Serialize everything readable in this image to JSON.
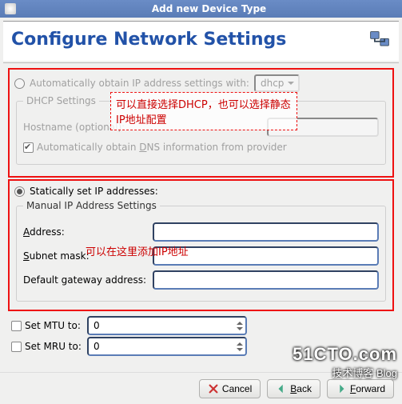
{
  "window": {
    "title": "Add new Device Type"
  },
  "header": {
    "title": "Configure Network Settings"
  },
  "auto_group": {
    "radio_label": "Automatically obtain IP address settings with:",
    "proto_selected": "dhcp",
    "dhcp_legend": "DHCP Settings",
    "hostname_label": "Hostname (optional):",
    "dns_checkbox_pre": "Automatically obtain ",
    "dns_checkbox_u": "D",
    "dns_checkbox_post": "NS information from provider"
  },
  "static_group": {
    "radio_label": "Statically set IP addresses:",
    "legend": "Manual IP Address Settings",
    "address_label_u": "A",
    "address_label_post": "ddress:",
    "subnet_label_u": "S",
    "subnet_label_post": "ubnet mask:",
    "gateway_label": "Default gateway address:",
    "address_value": "",
    "subnet_value": "",
    "gateway_value": ""
  },
  "mtu": {
    "label": "Set MTU to:",
    "value": "0"
  },
  "mru": {
    "label": "Set MRU to:",
    "value": "0"
  },
  "buttons": {
    "cancel": "Cancel",
    "back_u": "B",
    "back_post": "ack",
    "forward_u": "F",
    "forward_post": "orward"
  },
  "annotations": {
    "top": "可以直接选择DHCP，也可以选择静态IP地址配置",
    "mid": "可以在这里添加IP地址"
  },
  "watermark": {
    "line1": "51CTO.com",
    "line2": "技术博客    Blog"
  }
}
